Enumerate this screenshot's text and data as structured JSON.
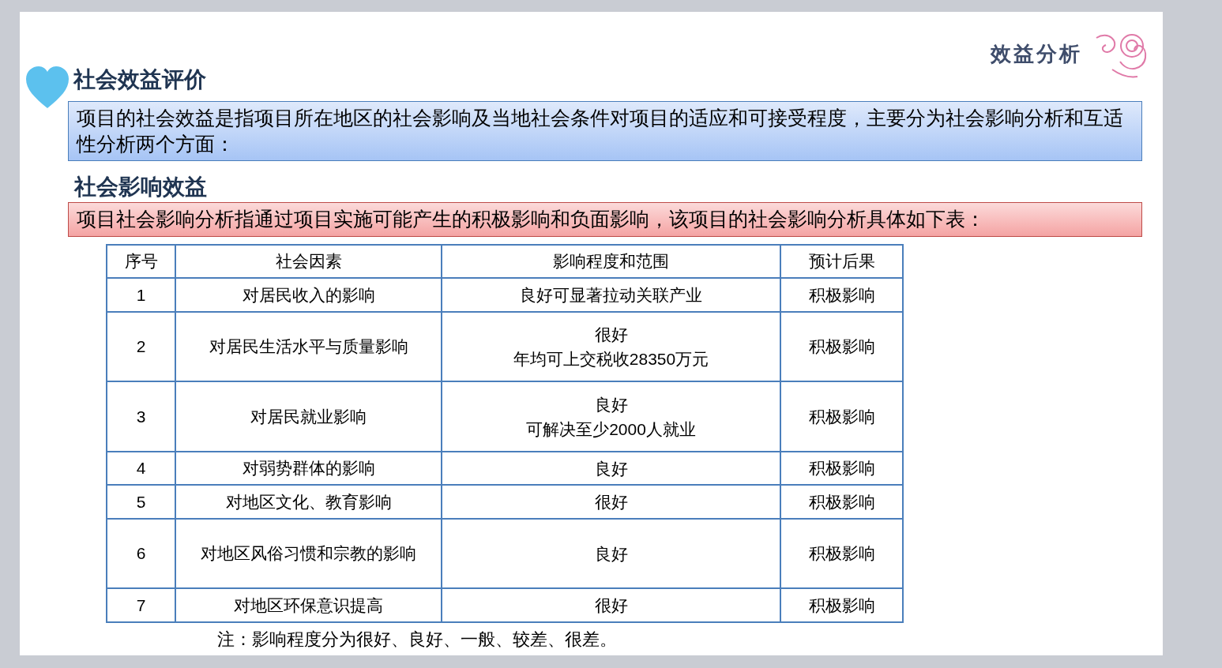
{
  "slide": {
    "corner_title": "效益分析",
    "heading": "社会效益评价",
    "intro": "项目的社会效益是指项目所在地区的社会影响及当地社会条件对项目的适应和可接受程度，主要分为社会影响分析和互适性分析两个方面：",
    "subheading": "社会影响效益",
    "note_box": "项目社会影响分析指通过项目实施可能产生的积极影响和负面影响，该项目的社会影响分析具体如下表：",
    "table": {
      "columns": [
        "序号",
        "社会因素",
        "影响程度和范围",
        "预计后果"
      ],
      "rows": [
        {
          "cells": [
            "1",
            "对居民收入的影响",
            [
              "良好可显著拉动关联产业"
            ],
            "积极影响"
          ]
        },
        {
          "cells": [
            "2",
            "对居民生活水平与质量影响",
            [
              "很好",
              "年均可上交税收28350万元"
            ],
            "积极影响"
          ]
        },
        {
          "cells": [
            "3",
            "对居民就业影响",
            [
              "良好",
              "可解决至少2000人就业"
            ],
            "积极影响"
          ]
        },
        {
          "cells": [
            "4",
            "对弱势群体的影响",
            [
              "良好"
            ],
            "积极影响"
          ]
        },
        {
          "cells": [
            "5",
            "对地区文化、教育影响",
            [
              "很好"
            ],
            "积极影响"
          ]
        },
        {
          "cells": [
            "6",
            "对地区风俗习惯和宗教的影响",
            [
              "良好"
            ],
            "积极影响"
          ]
        },
        {
          "cells": [
            "7",
            "对地区环保意识提高",
            [
              "很好"
            ],
            "积极影响"
          ]
        }
      ]
    },
    "footnote": "注：影响程度分为很好、良好、一般、较差、很差。"
  }
}
